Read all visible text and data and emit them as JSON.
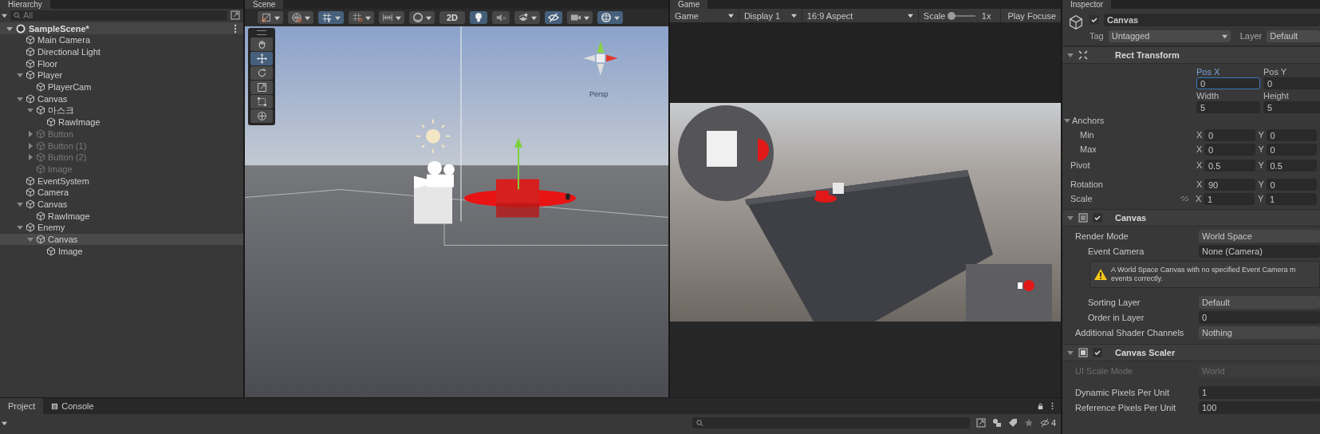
{
  "hierarchy": {
    "tab": "Hierarchy",
    "search": {
      "placeholder": "All"
    },
    "scene": {
      "name": "SampleScene*",
      "expanded": true
    },
    "items": [
      {
        "name": "Main Camera",
        "disabled": false,
        "selected": false
      },
      {
        "name": "Directional Light",
        "disabled": false,
        "selected": false
      },
      {
        "name": "Floor",
        "disabled": false,
        "selected": false
      },
      {
        "name": "Player",
        "disabled": false,
        "selected": false,
        "expanded": true,
        "children": [
          {
            "name": "PlayerCam",
            "disabled": false,
            "selected": false
          }
        ]
      },
      {
        "name": "Canvas",
        "disabled": false,
        "selected": false,
        "expanded": true,
        "children": [
          {
            "name": "마스크",
            "disabled": false,
            "selected": false,
            "expanded": true,
            "children": [
              {
                "name": "RawImage",
                "disabled": false,
                "selected": false
              }
            ]
          },
          {
            "name": "Button",
            "disabled": true,
            "selected": false,
            "expanded": false
          },
          {
            "name": "Button (1)",
            "disabled": true,
            "selected": false,
            "expanded": false
          },
          {
            "name": "Button (2)",
            "disabled": true,
            "selected": false,
            "expanded": false
          },
          {
            "name": "Image",
            "disabled": true,
            "selected": false
          }
        ]
      },
      {
        "name": "EventSystem",
        "disabled": false,
        "selected": false
      },
      {
        "name": "Camera",
        "disabled": false,
        "selected": false
      },
      {
        "name": "Canvas",
        "disabled": false,
        "selected": false,
        "expanded": true,
        "children": [
          {
            "name": "RawImage",
            "disabled": false,
            "selected": false
          }
        ]
      },
      {
        "name": "Enemy",
        "disabled": false,
        "selected": false,
        "expanded": true,
        "children": [
          {
            "name": "Canvas",
            "disabled": false,
            "selected": true,
            "expanded": true,
            "children": [
              {
                "name": "Image",
                "disabled": false,
                "selected": false
              }
            ]
          }
        ]
      }
    ]
  },
  "scene": {
    "tab": "Scene",
    "toolbar": [
      {
        "selected": false,
        "dropdown": true
      },
      {
        "selected": false,
        "dropdown": true
      },
      {
        "selected": true,
        "dropdown": true
      },
      {
        "selected": false,
        "dropdown": true
      },
      {
        "selected": false,
        "dropdown": true
      },
      {
        "selected": false,
        "dropdown": true
      },
      {
        "label": "2D",
        "selected": false,
        "dropdown": false
      },
      {
        "selected": true,
        "dropdown": false
      },
      {
        "selected": false,
        "dropdown": false
      },
      {
        "selected": false,
        "dropdown": true
      },
      {
        "selected": true,
        "dropdown": false
      },
      {
        "selected": false,
        "dropdown": true
      },
      {
        "selected": true,
        "dropdown": true
      }
    ],
    "tools": [
      {
        "selected": false
      },
      {
        "selected": true
      },
      {
        "selected": false
      },
      {
        "selected": false
      },
      {
        "selected": false
      },
      {
        "selected": false
      }
    ],
    "gizmo_label": "Persp"
  },
  "game": {
    "tab": "Game",
    "mode": "Game",
    "display": "Display 1",
    "aspect": "16:9 Aspect",
    "scale_label": "Scale",
    "scale": {
      "level": 0.05
    },
    "scale_value": "1x",
    "play_focused": "Play Focuse"
  },
  "inspector": {
    "tab": "Inspector",
    "object": {
      "active": true,
      "name": "Canvas",
      "tag_label": "Tag",
      "tag": "Untagged",
      "layer_label": "Layer",
      "layer": "Default"
    },
    "components": [
      {
        "kind": "rect_transform",
        "title": "Rect Transform",
        "expanded": true,
        "pos_fields": [
          {
            "label": "Pos X",
            "value": "0",
            "focused": true
          },
          {
            "label": "Pos Y",
            "value": "0",
            "focused": false
          },
          {
            "label": "Width",
            "value": "5",
            "focused": false
          },
          {
            "label": "Height",
            "value": "5",
            "focused": false
          }
        ],
        "anchors": {
          "label": "Anchors",
          "expanded": true,
          "rows": [
            {
              "label": "Min",
              "x": {
                "axis": "X",
                "value": "0"
              },
              "y": {
                "axis": "Y",
                "value": "0"
              }
            },
            {
              "label": "Max",
              "x": {
                "axis": "X",
                "value": "0"
              },
              "y": {
                "axis": "Y",
                "value": "0"
              }
            }
          ]
        },
        "rows": [
          {
            "label": "Pivot",
            "x": {
              "axis": "X",
              "value": "0.5"
            },
            "y": {
              "axis": "Y",
              "value": "0.5"
            }
          },
          {
            "label": "Rotation",
            "x": {
              "axis": "X",
              "value": "90"
            },
            "y": {
              "axis": "Y",
              "value": "0"
            }
          },
          {
            "label": "Scale",
            "x": {
              "axis": "X",
              "value": "1"
            },
            "y": {
              "axis": "Y",
              "value": "1"
            },
            "linked": false
          }
        ]
      },
      {
        "kind": "canvas",
        "title": "Canvas",
        "enabled": true,
        "expanded": true,
        "props": [
          {
            "kind": "dropdown",
            "label": "Render Mode",
            "value": "World Space",
            "disabled": false,
            "children": [
              {
                "kind": "object",
                "label": "Event Camera",
                "value": "None (Camera)",
                "disabled": false
              },
              {
                "kind": "warning",
                "lines": [
                  "A World Space Canvas with no specified Event Camera m",
                  "events correctly."
                ]
              },
              {
                "kind": "dropdown",
                "label": "Sorting Layer",
                "value": "Default",
                "disabled": false
              },
              {
                "kind": "field",
                "label": "Order in Layer",
                "value": "0",
                "disabled": false
              }
            ]
          },
          {
            "kind": "dropdown",
            "label": "Additional Shader Channels",
            "value": "Nothing",
            "disabled": false
          }
        ]
      },
      {
        "kind": "canvas_scaler",
        "title": "Canvas Scaler",
        "enabled": true,
        "expanded": true,
        "props": [
          {
            "kind": "dropdown",
            "label": "UI Scale Mode",
            "value": "World",
            "disabled": true
          },
          {
            "kind": "field",
            "label": "Dynamic Pixels Per Unit",
            "value": "1",
            "disabled": false
          },
          {
            "kind": "field",
            "label": "Reference Pixels Per Unit",
            "value": "100",
            "disabled": false
          }
        ]
      }
    ]
  },
  "bottom": {
    "tabs": [
      {
        "label": "Project",
        "selected": true
      },
      {
        "label": "Console",
        "selected": false
      }
    ],
    "hidden_count": "4"
  }
}
